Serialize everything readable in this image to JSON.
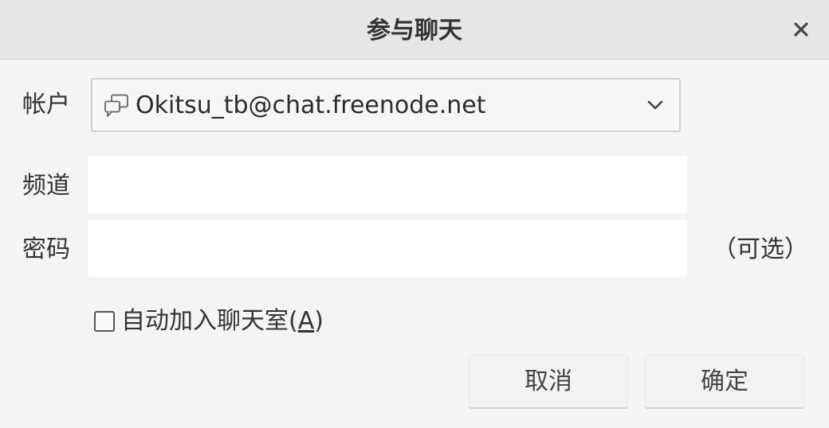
{
  "window": {
    "title": "参与聊天"
  },
  "form": {
    "account": {
      "label": "帐户",
      "selected_value": "Okitsu_tb@chat.freenode.net",
      "icon": "chat-bubbles-icon"
    },
    "channel": {
      "label": "频道",
      "value": ""
    },
    "password": {
      "label": "密码",
      "value": "",
      "note": "（可选）"
    },
    "auto_join": {
      "label_prefix": "自动加入聊天室(",
      "mnemonic": "A",
      "label_suffix": ")",
      "checked": false
    }
  },
  "buttons": {
    "cancel_label": "取消",
    "ok_label": "确定"
  }
}
